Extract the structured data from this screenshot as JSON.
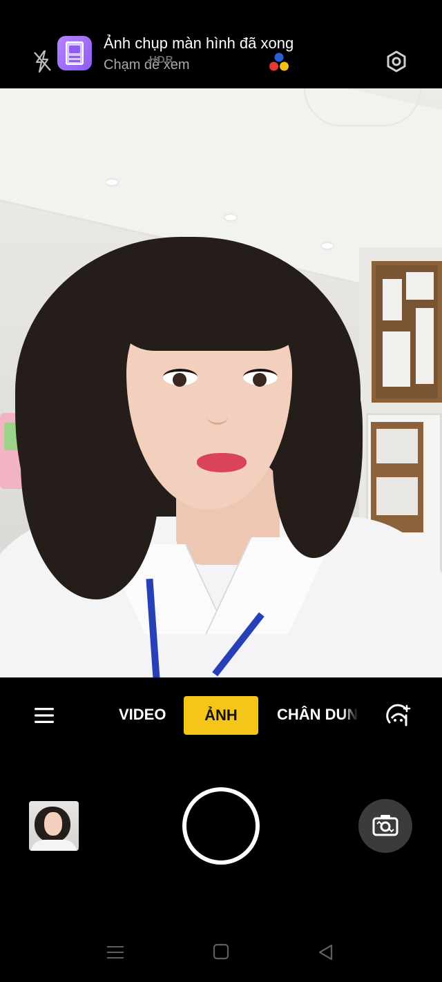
{
  "notification": {
    "title": "Ảnh chụp màn hình đã xong",
    "subtitle": "Chạm để xem",
    "hdr_tag": "HDR",
    "icons": [
      "flash-off-icon",
      "screenshot-app-icon",
      "color-dots-icon",
      "settings-icon"
    ]
  },
  "modes": {
    "video": "VIDEO",
    "photo": "ẢNH",
    "portrait": "CHÂN DUNG",
    "selected": "ẢNH",
    "highlight_color": "#f5c518"
  },
  "controls": {
    "menu_icon": "hamburger-menu-icon",
    "beauty_icon": "beauty-face-icon",
    "shutter_icon": "shutter-button",
    "flip_icon": "flip-camera-icon",
    "thumbnail": "last-photo-thumbnail"
  },
  "navbar": {
    "icons": [
      "recents-icon",
      "home-icon",
      "back-icon"
    ]
  }
}
